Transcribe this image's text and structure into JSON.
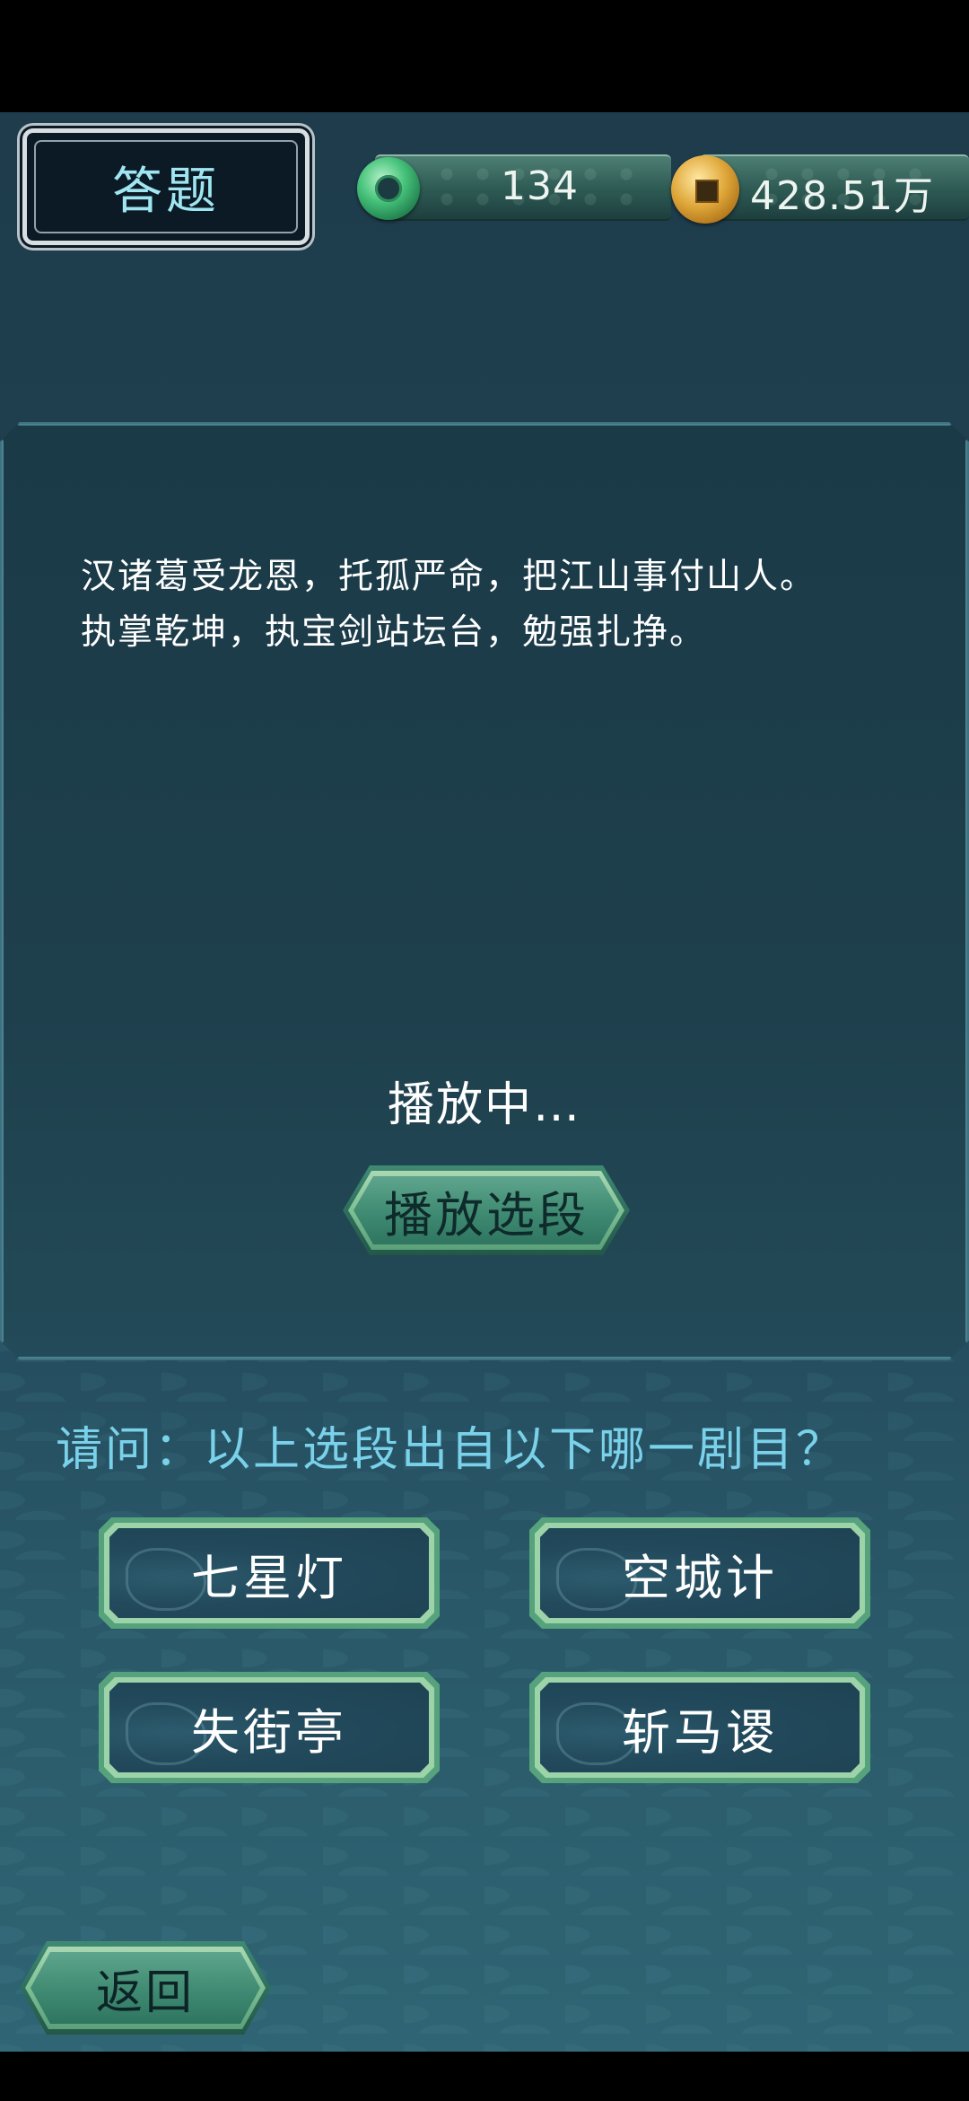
{
  "header": {
    "title": "答题",
    "jade_count": "134",
    "coin_amount": "428.51万"
  },
  "card": {
    "lyrics_line1": "汉诸葛受龙恩，托孤严命，把江山事付山人。",
    "lyrics_line2": "执掌乾坤，执宝剑站坛台，勉强扎挣。",
    "status": "播放中…",
    "play_button": "播放选段"
  },
  "question": "请问：以上选段出自以下哪一剧目？",
  "options": [
    {
      "label": "七星灯"
    },
    {
      "label": "空城计"
    },
    {
      "label": "失街亭"
    },
    {
      "label": "斩马谡"
    }
  ],
  "footer": {
    "back_button": "返回"
  },
  "icons": {
    "jade": "jade-disc-icon",
    "coin": "copper-coin-icon"
  },
  "colors": {
    "question_text": "#7ad1ea",
    "title_text": "#9fe6f2",
    "button_green": "#3f8a72"
  }
}
